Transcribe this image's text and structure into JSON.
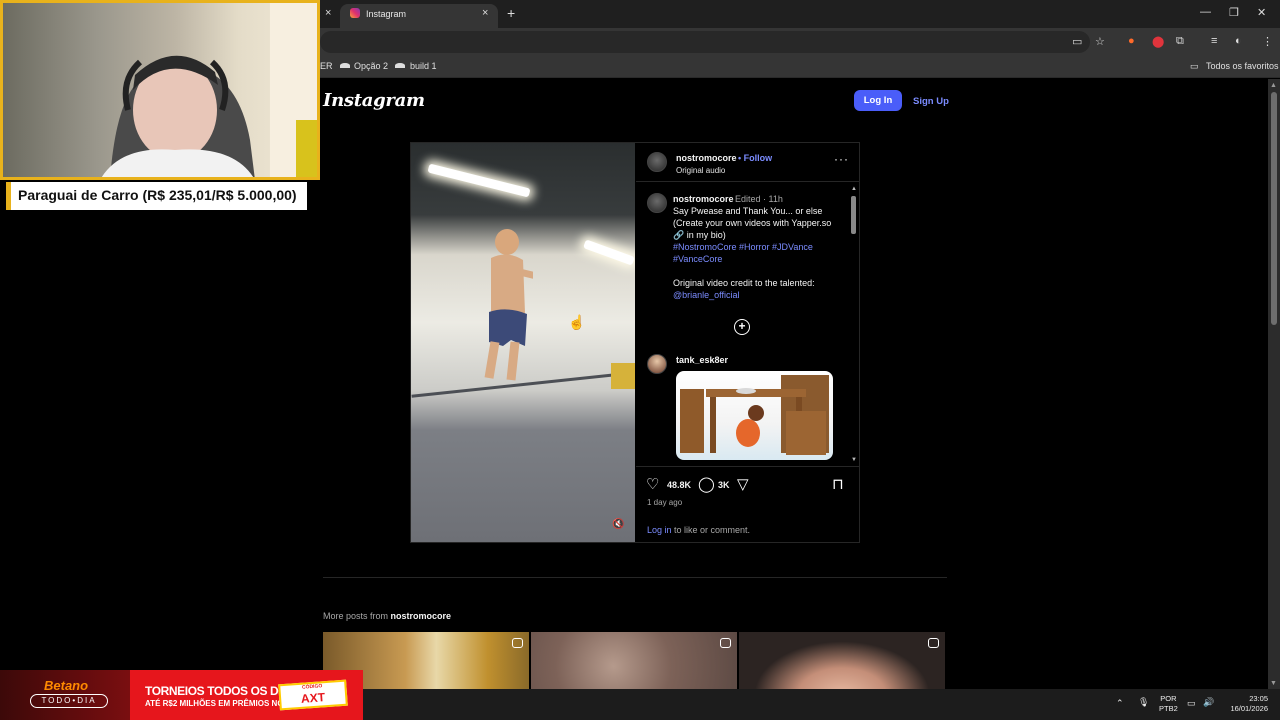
{
  "browser": {
    "tab_title": "Instagram",
    "new_tab": "+",
    "close_glyph": "×",
    "bookmarks": [
      "ER",
      "Opção 2",
      "build 1"
    ],
    "favorites_label": "Todos os favoritos"
  },
  "instagram": {
    "logo": "Instagram",
    "login_button": "Log In",
    "signup_link": "Sign Up",
    "post": {
      "author": "nostromocore",
      "follow": "• Follow",
      "audio": "Original audio",
      "caption": {
        "author": "nostromocore",
        "edited": "Edited · 11h",
        "line1": "Say Pwease and Thank You... or else",
        "line2": "(Create your own videos with Yapper.so",
        "line3": "🔗 in my bio)",
        "hashtags_1": "#NostromoCore #Horror #JDVance",
        "hashtags_2": "#VanceCore",
        "credit": "Original video credit to the talented:",
        "mention": "@brianle_official"
      },
      "comment": {
        "user": "tank_esk8er"
      },
      "likes": "48.8K",
      "comments": "3K",
      "time_ago": "1 day ago",
      "login_prompt_link": "Log in",
      "login_prompt_rest": " to like or comment."
    },
    "more_posts_prefix": "More posts from ",
    "more_posts_user": "nostromocore"
  },
  "stream": {
    "status": "Paraguai de Carro (R$ 235,01/R$ 5.000,00)",
    "ad": {
      "brand": "Betano",
      "brand_sub": "TODO•DIA",
      "title": "TORNEIOS TODOS OS DIAS!",
      "subtitle": "ATÉ R$2 MILHÕES EM PRÊMIOS NO MÊS.",
      "code_label": "CÓDIGO",
      "code": "AXT"
    }
  },
  "taskbar": {
    "lang_1": "POR",
    "lang_2": "PTB2",
    "time": "23:05",
    "date": "16/01/2026"
  },
  "colors": {
    "accent": "#4a5df9",
    "link": "#7b8cff",
    "webcam_border": "#e8b21c",
    "ad_red": "#e6161c"
  },
  "icons": [
    "instagram-icon",
    "heart-icon",
    "comment-icon",
    "share-icon",
    "bookmark-icon",
    "mute-icon",
    "more-icon",
    "add-icon",
    "reel-icon",
    "star-icon",
    "mic-icon",
    "volume-icon"
  ]
}
